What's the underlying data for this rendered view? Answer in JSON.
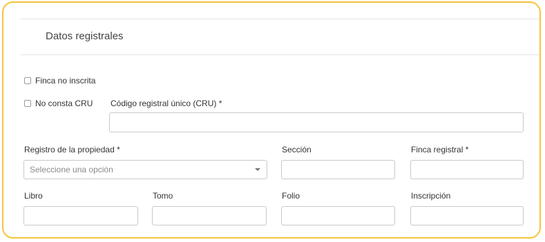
{
  "section": {
    "title": "Datos registrales"
  },
  "checkboxes": {
    "finca_no_inscrita": "Finca no inscrita",
    "no_consta_cru": "No consta CRU"
  },
  "fields": {
    "cru_label": "Código registral único (CRU) *",
    "registro_label": "Registro de la propiedad *",
    "registro_placeholder": "Seleccione una opción",
    "seccion_label": "Sección",
    "finca_registral_label": "Finca registral *",
    "libro_label": "Libro",
    "tomo_label": "Tomo",
    "folio_label": "Folio",
    "inscripcion_label": "Inscripción"
  },
  "colors": {
    "card_border": "#f5c43d",
    "input_border": "#c9c9c9"
  }
}
